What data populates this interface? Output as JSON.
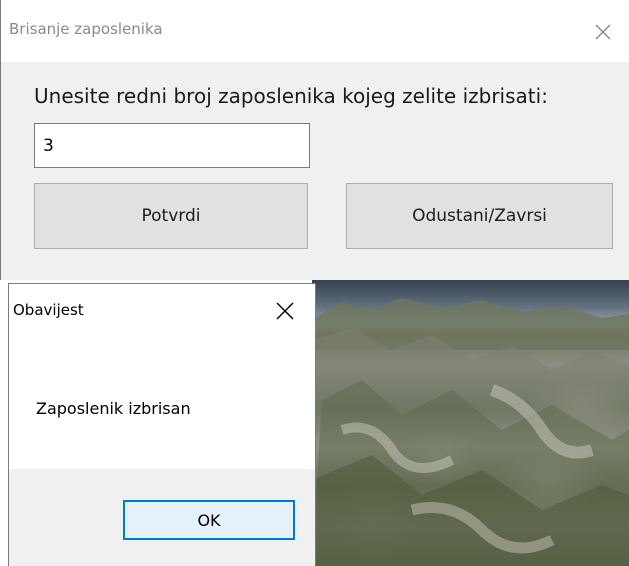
{
  "main_window": {
    "title": "Brisanje zaposlenika",
    "prompt": "Unesite redni broj zaposlenika kojeg zelite izbrisati:",
    "input_value": "3",
    "confirm_label": "Potvrdi",
    "cancel_label": "Odustani/Zavrsi"
  },
  "message_box": {
    "title": "Obavijest",
    "message": "Zaposlenik izbrisan",
    "ok_label": "OK"
  },
  "colors": {
    "title_text_inactive": "#8a8a8a",
    "window_body": "#f0f0f0",
    "button_face": "#e1e1e1",
    "focus_accent": "#0078d7"
  },
  "icons": [
    "close-icon"
  ]
}
